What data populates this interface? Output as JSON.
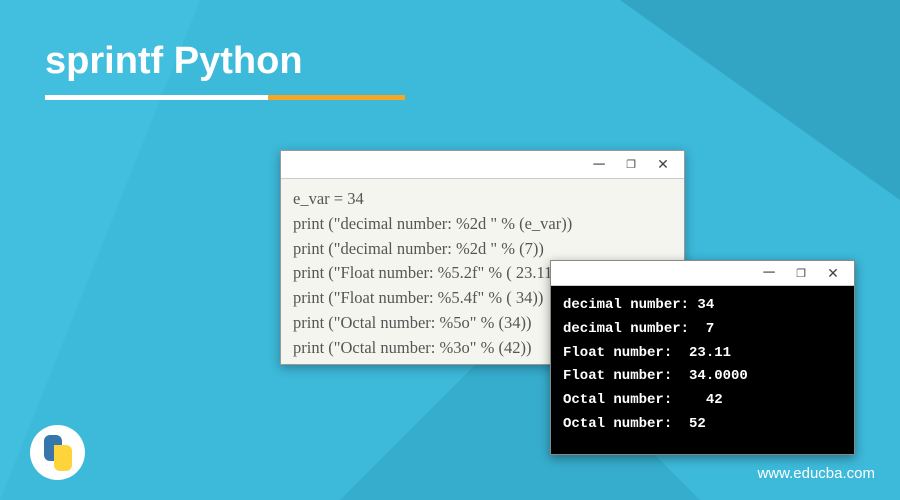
{
  "header": {
    "title": "sprintf Python"
  },
  "code_window": {
    "lines": [
      "e_var = 34",
      "print (\"decimal number: %2d \" % (e_var))",
      "print (\"decimal number: %2d \" % (7))",
      "print (\"Float number: %5.2f\" % ( 23.11))",
      "print (\"Float number: %5.4f\" % ( 34))",
      "print (\"Octal number: %5o\" % (34))",
      "print (\"Octal number: %3o\" % (42))"
    ]
  },
  "console_window": {
    "lines": [
      "decimal number: 34",
      "decimal number:  7",
      "Float number:  23.11",
      "Float number:  34.0000",
      "Octal number:    42",
      "Octal number:  52"
    ]
  },
  "footer": {
    "url": "www.educba.com"
  },
  "icons": {
    "minimize": "─",
    "maximize": "❐",
    "close": "✕"
  }
}
